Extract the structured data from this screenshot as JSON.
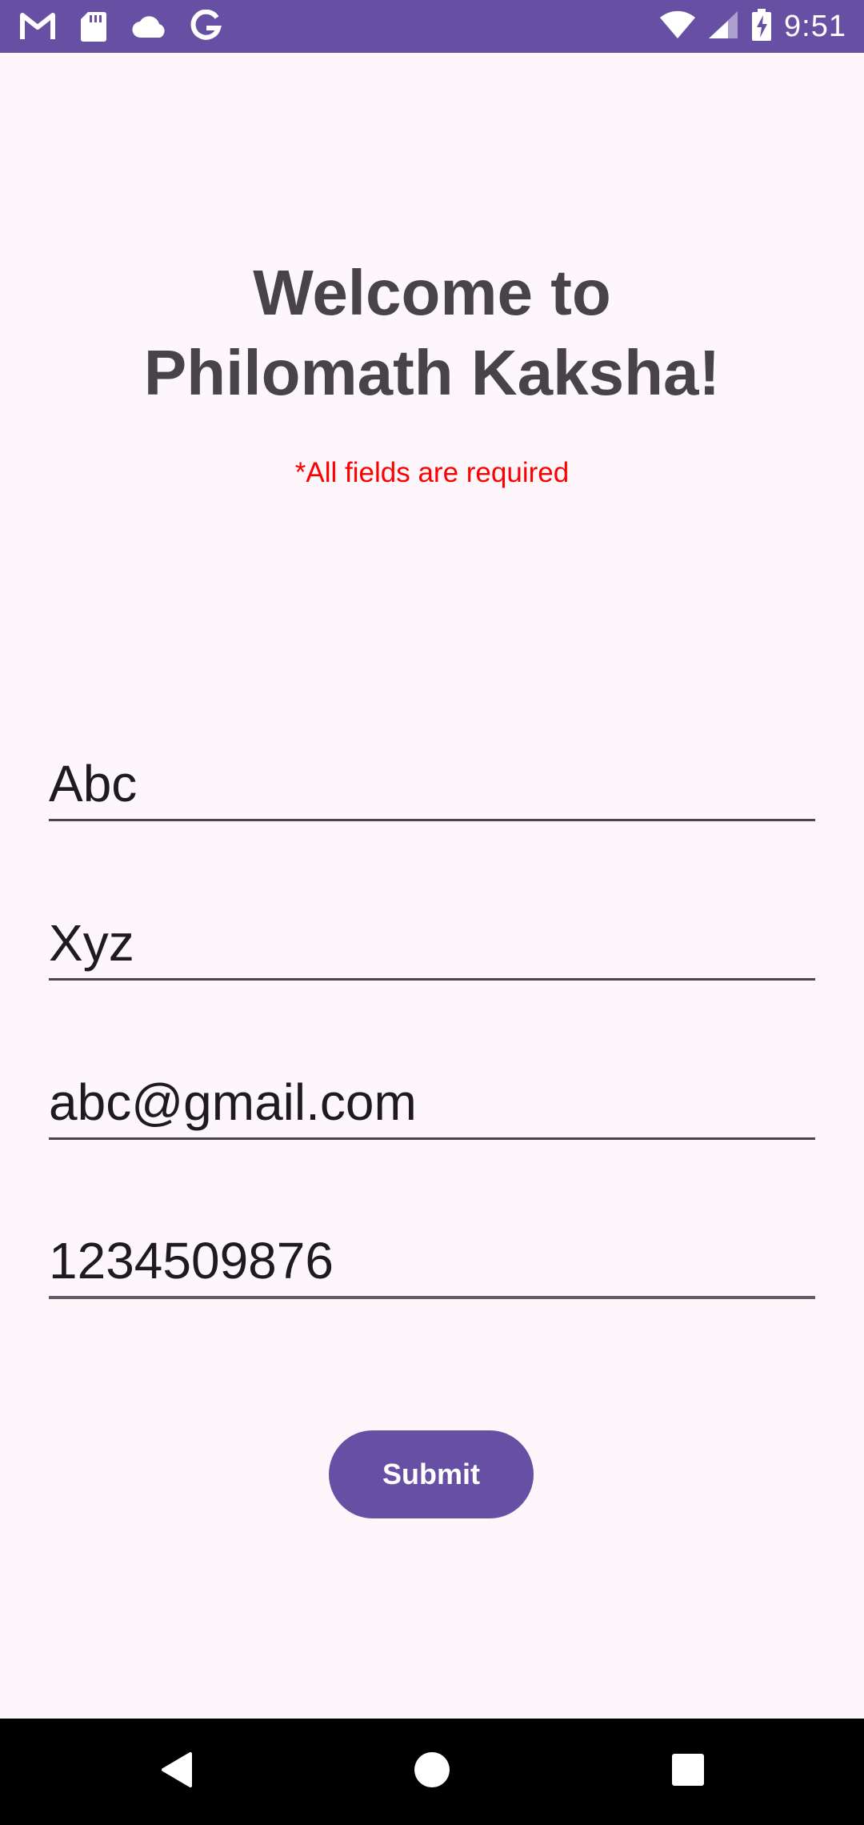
{
  "status_bar": {
    "time": "9:51",
    "left_icons": [
      "gmail-icon",
      "sd-card-icon",
      "cloud-icon",
      "google-icon"
    ],
    "right_icons": [
      "wifi-icon",
      "cell-signal-icon",
      "battery-charging-icon"
    ],
    "background_color": "#6750a4"
  },
  "header": {
    "title_line1": "Welcome to",
    "title_line2": "Philomath Kaksha!",
    "required_note": "*All fields are required"
  },
  "form": {
    "fields": [
      {
        "value": "Abc"
      },
      {
        "value": "Xyz"
      },
      {
        "value": "abc@gmail.com"
      },
      {
        "value": "1234509876"
      }
    ],
    "submit_label": "Submit"
  },
  "colors": {
    "accent": "#6750a4",
    "required_text": "#ff0000",
    "background": "#fdf7fb"
  },
  "nav_bar": {
    "buttons": [
      "back-icon",
      "home-icon",
      "recents-icon"
    ]
  }
}
